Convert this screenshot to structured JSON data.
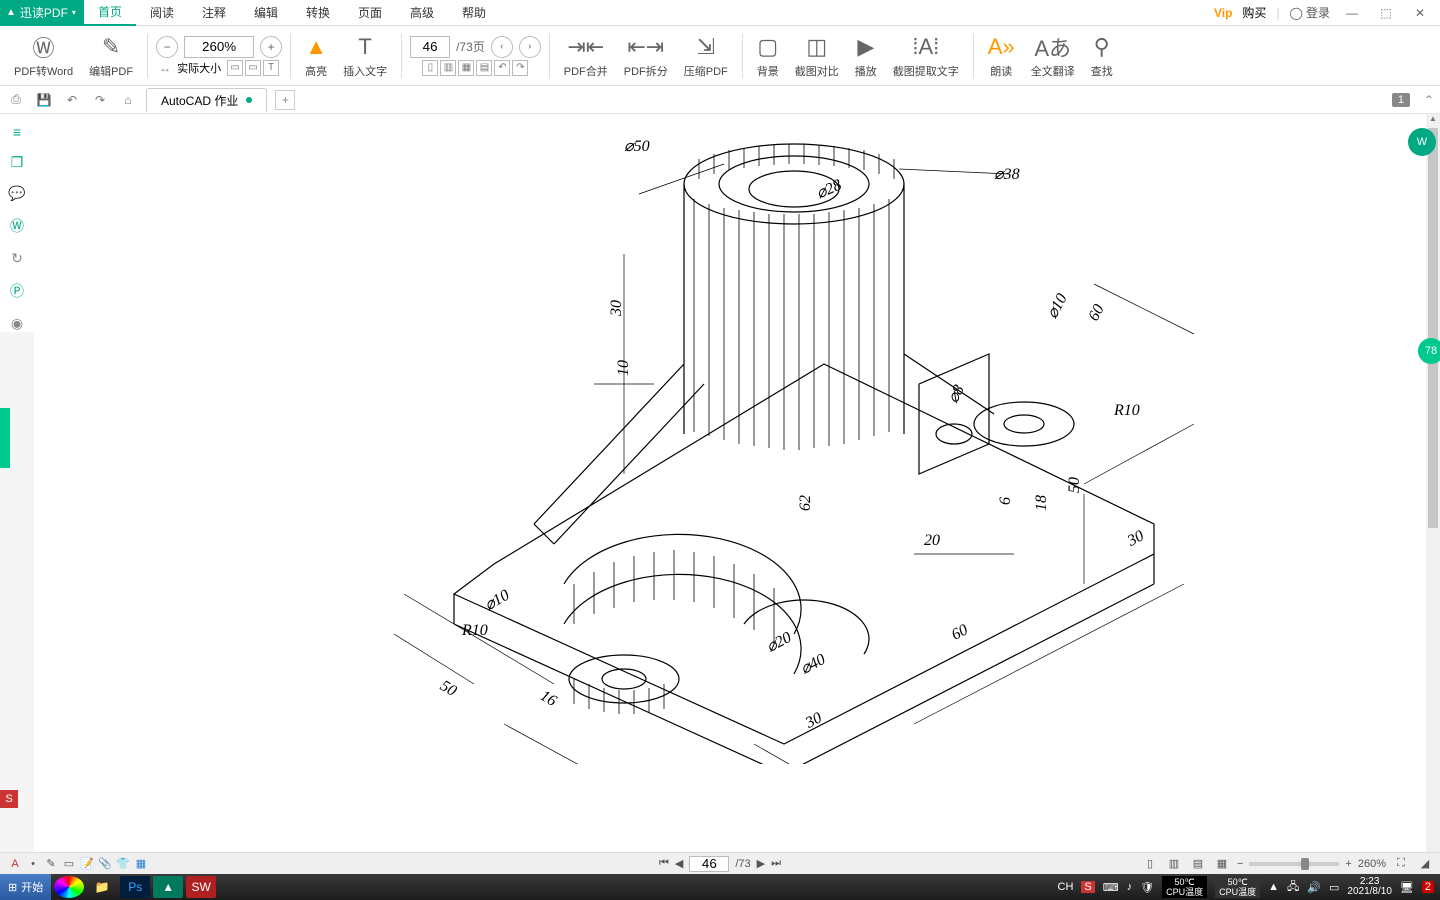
{
  "app": {
    "name": "迅读PDF"
  },
  "menu": {
    "items": [
      "首页",
      "阅读",
      "注释",
      "编辑",
      "转换",
      "页面",
      "高级",
      "帮助"
    ],
    "active": 0
  },
  "titlebar": {
    "vip": "Vip",
    "buy": "购买",
    "login": "登录"
  },
  "ribbon": {
    "pdf_to_word": "PDF转Word",
    "edit_pdf": "编辑PDF",
    "zoom_value": "260%",
    "actual_size": "实际大小",
    "highlight": "高亮",
    "insert_text": "插入文字",
    "page_current": "46",
    "page_total": "/73页",
    "merge": "PDF合并",
    "split": "PDF拆分",
    "compress": "压缩PDF",
    "background": "背景",
    "compare": "截图对比",
    "play": "播放",
    "ocr": "截图提取文字",
    "read_aloud": "朗读",
    "translate": "全文翻译",
    "find": "查找"
  },
  "doc": {
    "tab_name": "AutoCAD 作业",
    "page_indicator": "1"
  },
  "status": {
    "page_current": "46",
    "page_total": "/73",
    "zoom": "260%"
  },
  "float": {
    "badge78": "78"
  },
  "dims": {
    "d50": "⌀50",
    "d38": "⌀38",
    "d28": "⌀28",
    "d40": "⌀40",
    "d20": "⌀20",
    "d10a": "⌀10",
    "d10b": "⌀10",
    "d8": "⌀8",
    "r10a": "R10",
    "r10b": "R10",
    "v30": "30",
    "v10": "10",
    "v62": "62",
    "v60a": "60",
    "v60b": "60",
    "v50a": "50",
    "v50b": "50",
    "v30b": "30",
    "v30c": "30",
    "v20": "20",
    "v18": "18",
    "v16": "16",
    "v6": "6"
  },
  "taskbar": {
    "start": "开始",
    "lang": "CH",
    "temp": "50℃",
    "cpu_label": "CPU温度",
    "time": "2:23",
    "date": "2021/8/10",
    "badge": "2"
  }
}
